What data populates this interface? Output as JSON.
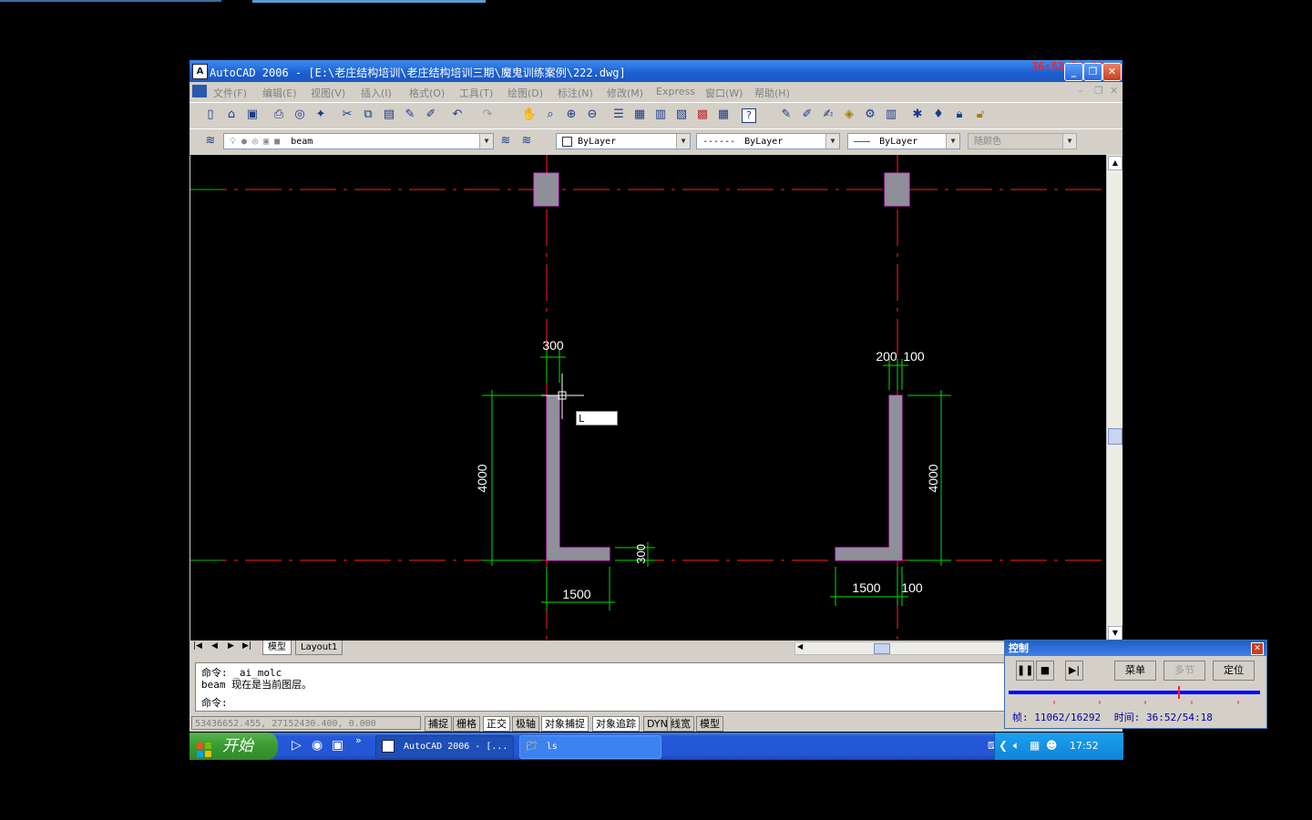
{
  "window": {
    "title": "AutoCAD 2006 - [E:\\老庄结构培训\\老庄结构培训三期\\魔鬼训练案例\\222.dwg]",
    "overlay_time": "36:52/54:18"
  },
  "menu": [
    "文件(F)",
    "编辑(E)",
    "视图(V)",
    "插入(I)",
    "格式(O)",
    "工具(T)",
    "绘图(D)",
    "标注(N)",
    "修改(M)",
    "Express",
    "窗口(W)",
    "帮助(H)"
  ],
  "layers_toolbar": {
    "layer_name": "beam",
    "color": "ByLayer",
    "linetype_dashes": "------",
    "linetype": "ByLayer",
    "lineweight_line": "———",
    "lineweight": "ByLayer",
    "plotstyle": "随颜色"
  },
  "drawing": {
    "dims": {
      "d_300_top": "300",
      "d_4000_left": "4000",
      "d_1500_left": "1500",
      "d_300_right_small": "300",
      "d_200": "200",
      "d_100_top": "100",
      "d_4000_right": "4000",
      "d_1500_right": "1500",
      "d_100_bottom": "100"
    },
    "cursor_input": "L"
  },
  "tabs": {
    "model": "模型",
    "layout1": "Layout1"
  },
  "command": {
    "line1": "命令: _ai_molc",
    "line2": "beam 现在是当前图层。",
    "line3": "命令:"
  },
  "status": {
    "coords": "53436652.455, 27152430.400, 0.000",
    "buttons": [
      "捕捉",
      "栅格",
      "正交",
      "极轴",
      "对象捕捉",
      "对象追踪",
      "DYN",
      "线宽",
      "模型"
    ]
  },
  "taskbar": {
    "start": "开始",
    "task1": "AutoCAD 2006 - [...",
    "task2": "ls",
    "clock": "17:52",
    "quicklaunch_more": "»"
  },
  "control_panel": {
    "title": "控制",
    "menu_btn": "菜单",
    "multi_btn": "多节",
    "locate_btn": "定位",
    "frame_label": "帧:",
    "frame_value": "11062/16292",
    "time_label": "时间:",
    "time_value": "36:52/54:18",
    "progress": 0.679
  }
}
